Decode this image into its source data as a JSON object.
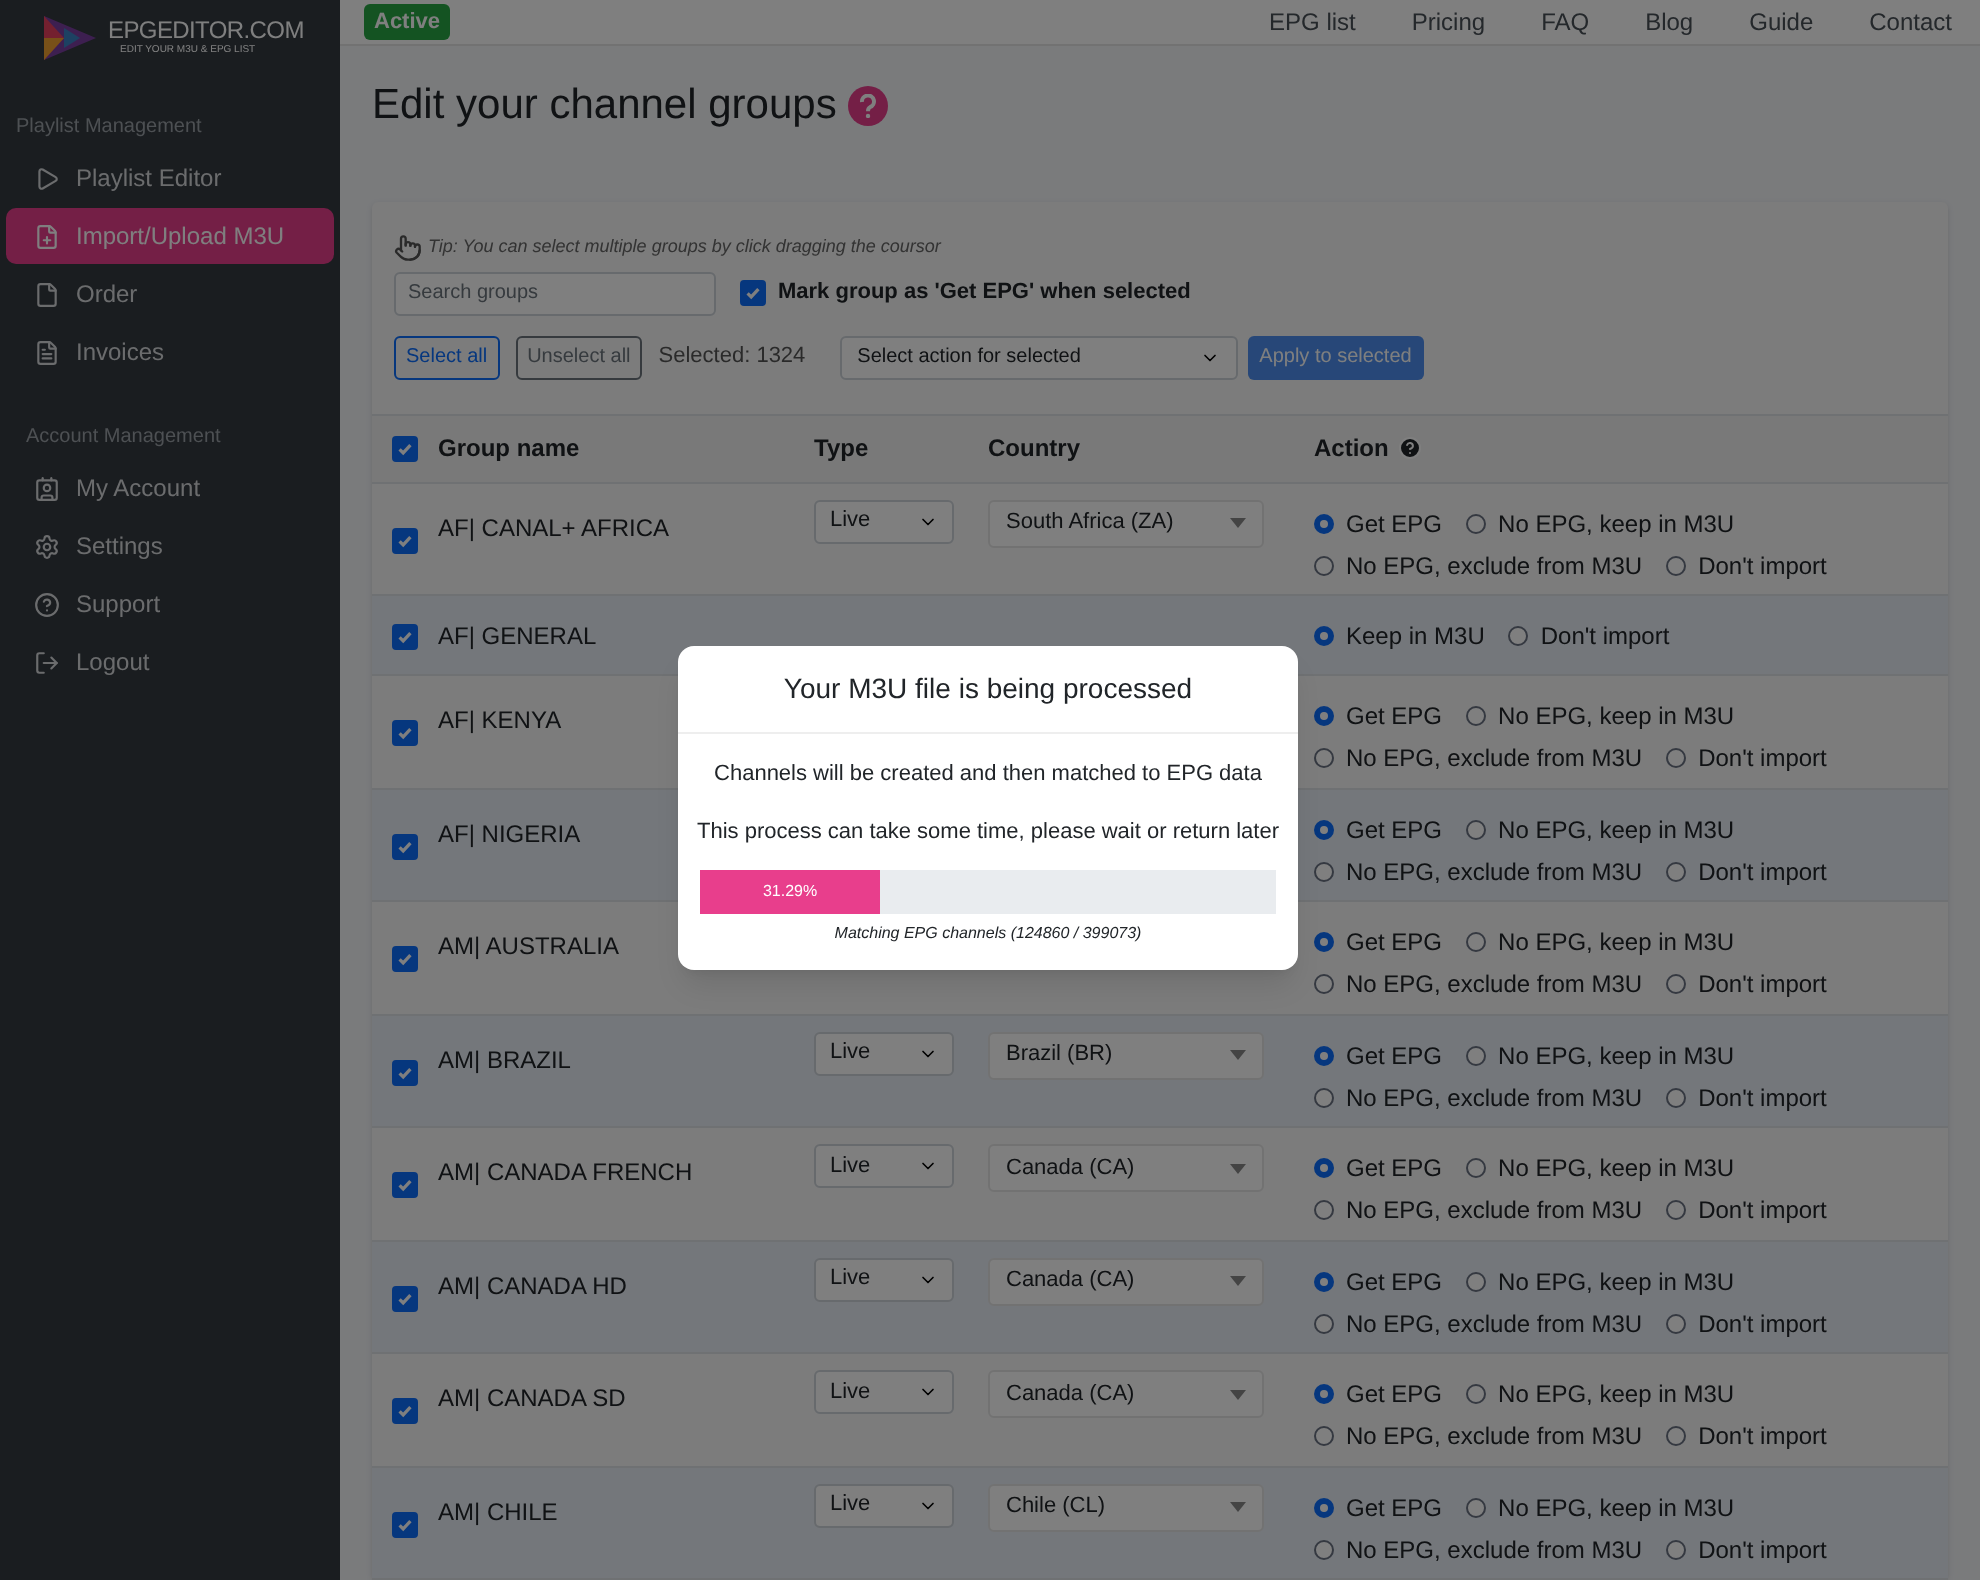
{
  "navbar": {
    "status_badge": "Active",
    "links": [
      "EPG list",
      "Pricing",
      "FAQ",
      "Blog",
      "Guide",
      "Contact"
    ]
  },
  "sidebar": {
    "logo": {
      "title": "EPGEDITOR.COM",
      "tagline": "EDIT YOUR M3U & EPG LIST"
    },
    "sections": [
      {
        "heading": "Playlist Management",
        "items": [
          {
            "label": "Playlist Editor",
            "selected": false
          },
          {
            "label": "Import/Upload M3U",
            "selected": true
          },
          {
            "label": "Order",
            "selected": false
          },
          {
            "label": "Invoices",
            "selected": false
          }
        ]
      },
      {
        "heading": "Account Management",
        "items": [
          {
            "label": "My Account",
            "selected": false
          },
          {
            "label": "Settings",
            "selected": false
          },
          {
            "label": "Support",
            "selected": false
          },
          {
            "label": "Logout",
            "selected": false
          }
        ]
      }
    ]
  },
  "page_title": "Edit your channel groups",
  "toolbar": {
    "tip": "Tip: You can select multiple groups by click dragging the coursor",
    "search": {
      "placeholder": "Search groups"
    },
    "mark_get_epg": {
      "label": "Mark group as 'Get EPG' when selected",
      "checked": true
    },
    "select_all": "Select all",
    "unselect_all": "Unselect all",
    "selected_count": "Selected: 1324",
    "action_select": "Select action for selected",
    "apply": "Apply to selected"
  },
  "table": {
    "all_checked": true,
    "columns": [
      "Group name",
      "Type",
      "Country",
      "Action"
    ],
    "rows": [
      {
        "name": "AF| CANAL+ AFRICA",
        "checked": true,
        "type": "Live",
        "country": "South Africa (ZA)",
        "kind": "epg",
        "options": [
          {
            "label": "Get EPG",
            "selected": true
          },
          {
            "label": "No EPG, keep in M3U",
            "selected": false
          },
          {
            "label": "No EPG, exclude from M3U",
            "selected": false
          },
          {
            "label": "Don't import",
            "selected": false
          }
        ]
      },
      {
        "name": "AF| GENERAL",
        "checked": true,
        "kind": "keep",
        "options": [
          {
            "label": "Keep in M3U",
            "selected": true
          },
          {
            "label": "Don't import",
            "selected": false
          }
        ]
      },
      {
        "name": "AF| KENYA",
        "checked": true,
        "kind": "epg",
        "options": [
          {
            "label": "Get EPG",
            "selected": true
          },
          {
            "label": "No EPG, keep in M3U",
            "selected": false
          },
          {
            "label": "No EPG, exclude from M3U",
            "selected": false
          },
          {
            "label": "Don't import",
            "selected": false
          }
        ]
      },
      {
        "name": "AF| NIGERIA",
        "checked": true,
        "kind": "epg",
        "options": [
          {
            "label": "Get EPG",
            "selected": true
          },
          {
            "label": "No EPG, keep in M3U",
            "selected": false
          },
          {
            "label": "No EPG, exclude from M3U",
            "selected": false
          },
          {
            "label": "Don't import",
            "selected": false
          }
        ]
      },
      {
        "name": "AM| AUSTRALIA",
        "checked": true,
        "kind": "epg",
        "options": [
          {
            "label": "Get EPG",
            "selected": true
          },
          {
            "label": "No EPG, keep in M3U",
            "selected": false
          },
          {
            "label": "No EPG, exclude from M3U",
            "selected": false
          },
          {
            "label": "Don't import",
            "selected": false
          }
        ]
      },
      {
        "name": "AM| BRAZIL",
        "checked": true,
        "type": "Live",
        "country": "Brazil (BR)",
        "kind": "epg",
        "options": [
          {
            "label": "Get EPG",
            "selected": true
          },
          {
            "label": "No EPG, keep in M3U",
            "selected": false
          },
          {
            "label": "No EPG, exclude from M3U",
            "selected": false
          },
          {
            "label": "Don't import",
            "selected": false
          }
        ]
      },
      {
        "name": "AM| CANADA FRENCH",
        "checked": true,
        "type": "Live",
        "country": "Canada (CA)",
        "kind": "epg",
        "options": [
          {
            "label": "Get EPG",
            "selected": true
          },
          {
            "label": "No EPG, keep in M3U",
            "selected": false
          },
          {
            "label": "No EPG, exclude from M3U",
            "selected": false
          },
          {
            "label": "Don't import",
            "selected": false
          }
        ]
      },
      {
        "name": "AM| CANADA HD",
        "checked": true,
        "type": "Live",
        "country": "Canada (CA)",
        "kind": "epg",
        "options": [
          {
            "label": "Get EPG",
            "selected": true
          },
          {
            "label": "No EPG, keep in M3U",
            "selected": false
          },
          {
            "label": "No EPG, exclude from M3U",
            "selected": false
          },
          {
            "label": "Don't import",
            "selected": false
          }
        ]
      },
      {
        "name": "AM| CANADA SD",
        "checked": true,
        "type": "Live",
        "country": "Canada (CA)",
        "kind": "epg",
        "options": [
          {
            "label": "Get EPG",
            "selected": true
          },
          {
            "label": "No EPG, keep in M3U",
            "selected": false
          },
          {
            "label": "No EPG, exclude from M3U",
            "selected": false
          },
          {
            "label": "Don't import",
            "selected": false
          }
        ]
      },
      {
        "name": "AM| CHILE",
        "checked": true,
        "type": "Live",
        "country": "Chile (CL)",
        "kind": "epg",
        "options": [
          {
            "label": "Get EPG",
            "selected": true
          },
          {
            "label": "No EPG, keep in M3U",
            "selected": false
          },
          {
            "label": "No EPG, exclude from M3U",
            "selected": false
          },
          {
            "label": "Don't import",
            "selected": false
          }
        ]
      }
    ]
  },
  "modal": {
    "title": "Your M3U file is being processed",
    "lines": [
      "Channels will be created and then matched to EPG data",
      "This process can take some time, please wait or return later"
    ],
    "progress": {
      "level": 0.3129,
      "label": "31.29%"
    },
    "status": "Matching EPG channels (124860 / 399073)"
  }
}
